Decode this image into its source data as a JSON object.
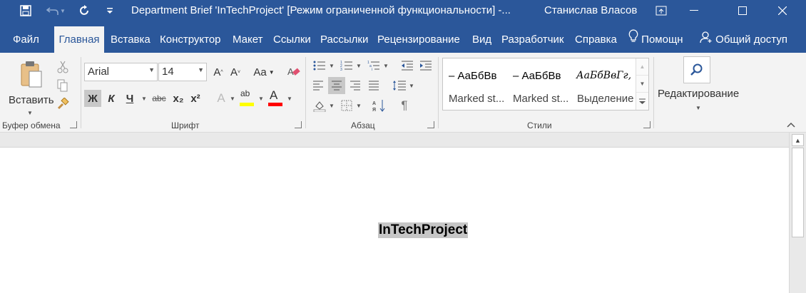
{
  "titlebar": {
    "save_icon": "save-icon",
    "undo_icon": "undo-icon",
    "redo_icon": "redo-icon",
    "customize_icon": "customize-qat-icon",
    "title": "Department Brief 'InTechProject' [Режим ограниченной функциональности]  -...",
    "user": "Станислав Власов",
    "ribbon_display_icon": "ribbon-display-options-icon",
    "minimize_icon": "minimize-icon",
    "maximize_icon": "maximize-icon",
    "close_icon": "close-icon"
  },
  "tabs": [
    {
      "label": "Файл"
    },
    {
      "label": "Главная",
      "active": true
    },
    {
      "label": "Вставка"
    },
    {
      "label": "Конструктор"
    },
    {
      "label": "Макет"
    },
    {
      "label": "Ссылки"
    },
    {
      "label": "Рассылки"
    },
    {
      "label": "Рецензирование"
    },
    {
      "label": "Вид"
    },
    {
      "label": "Разработчик"
    },
    {
      "label": "Справка"
    },
    {
      "label": "Помощн",
      "icon": "lightbulb-icon"
    },
    {
      "label": "Общий доступ",
      "icon": "share-person-icon"
    }
  ],
  "clipboard": {
    "paste_label": "Вставить",
    "group_label": "Буфер обмена"
  },
  "font": {
    "name": "Arial",
    "size": "14",
    "grow": "A",
    "shrink": "A",
    "case": "Aa",
    "bold": "Ж",
    "italic": "К",
    "underline": "Ч",
    "strike": "abc",
    "subscript": "x₂",
    "superscript": "x²",
    "effects": "A",
    "highlight": "ab",
    "font_color": "A",
    "highlight_color": "#ffff00",
    "font_color_value": "#ff0000",
    "group_label": "Шрифт"
  },
  "paragraph": {
    "group_label": "Абзац",
    "show_marks": "¶"
  },
  "styles": {
    "items": [
      {
        "sample": "– АаБбВв",
        "name": "Marked st..."
      },
      {
        "sample": "– АаБбВв",
        "name": "Marked st..."
      },
      {
        "sample": "АаБбВвГг,",
        "name": "Выделение"
      }
    ],
    "group_label": "Стили"
  },
  "editing": {
    "label": "Редактирование"
  },
  "document": {
    "heading": "InTechProject"
  },
  "colors": {
    "brand": "#2b579a",
    "ribbon": "#f3f3f3"
  }
}
